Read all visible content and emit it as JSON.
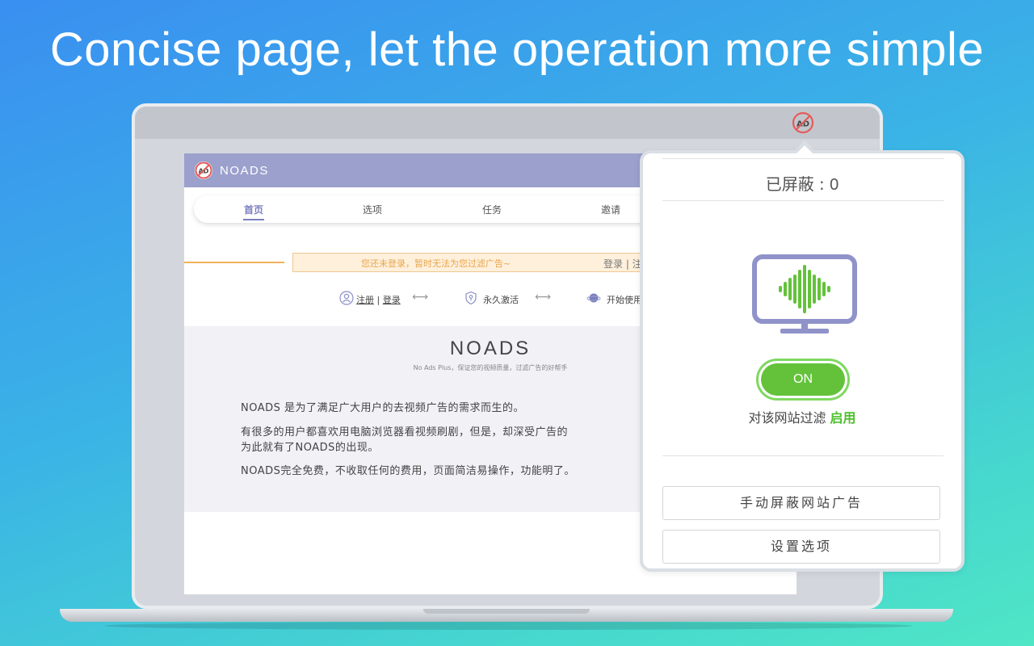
{
  "headline": "Concise page, let the operation more simple",
  "page": {
    "brand": "NOADS",
    "nav": [
      "首页",
      "选项",
      "任务",
      "邀请"
    ],
    "notice": {
      "text": "您还未登录，暂时无法为您过滤广告~",
      "login": "登录 | 注"
    },
    "steps": {
      "register": "注册",
      "separator": "|",
      "login": "登录",
      "activate": "永久激活",
      "start": "开始使用"
    },
    "about": {
      "title": "NOADS",
      "subtitle": "No Ads Plus，保证您的视频质量，过滤广告的好帮手",
      "p1": "NOADS 是为了满足广大用户的去视频广告的需求而生的。",
      "p2a": "有很多的用户都喜欢用电脑浏览器看视频刷剧，但是，却深受广告的",
      "p2b": "为此就有了NOADS的出现。",
      "p3": "NOADS完全免费，不收取任何的费用，页面简洁易操作，功能明了。"
    }
  },
  "popup": {
    "blocked_label": "已屏蔽 : ",
    "blocked_count": "0",
    "toggle_label": "ON",
    "filter_text": "对该网站过滤 ",
    "filter_status": "启用",
    "manual_block_button": "手动屏蔽网站广告",
    "settings_button": "设置选项"
  },
  "icons": {
    "extension": "no-ad-icon",
    "brand": "no-ad-icon",
    "monitor": "monitor-soundwave-icon",
    "user": "user-icon",
    "shield": "shield-key-icon",
    "planet": "planet-icon"
  },
  "colors": {
    "header": "#9ba0cc",
    "accent_green": "#63c23a",
    "nav_active": "#7b7fbf",
    "notice_text": "#e8a64a"
  }
}
